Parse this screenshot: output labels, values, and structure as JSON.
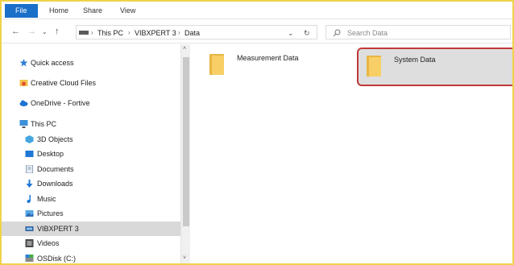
{
  "ribbon": {
    "tabs": [
      "File",
      "Home",
      "Share",
      "View"
    ]
  },
  "address": {
    "path": [
      "This PC",
      "VIBXPERT 3",
      "Data"
    ],
    "search_placeholder": "Search Data"
  },
  "nav": {
    "items": [
      {
        "label": "Quick access",
        "icon": "star-icon"
      },
      {
        "label": "Creative Cloud Files",
        "icon": "creative-cloud-icon"
      },
      {
        "label": "OneDrive - Fortive",
        "icon": "cloud-icon"
      },
      {
        "label": "This PC",
        "icon": "computer-icon"
      },
      {
        "label": "3D Objects",
        "icon": "cube-icon"
      },
      {
        "label": "Desktop",
        "icon": "desktop-icon"
      },
      {
        "label": "Documents",
        "icon": "document-icon"
      },
      {
        "label": "Downloads",
        "icon": "download-icon"
      },
      {
        "label": "Music",
        "icon": "music-icon"
      },
      {
        "label": "Pictures",
        "icon": "pictures-icon"
      },
      {
        "label": "VIBXPERT 3",
        "icon": "device-icon",
        "selected": true
      },
      {
        "label": "Videos",
        "icon": "video-icon"
      },
      {
        "label": "OSDisk (C:)",
        "icon": "drive-icon"
      }
    ]
  },
  "content": {
    "folders": [
      {
        "name": "Measurement Data"
      },
      {
        "name": "System Data",
        "selected": true
      }
    ]
  },
  "colors": {
    "accent": "#1a6fc9",
    "highlight_border": "#c0393b",
    "frame": "#f0d24a",
    "folder": "#f5c55a"
  }
}
